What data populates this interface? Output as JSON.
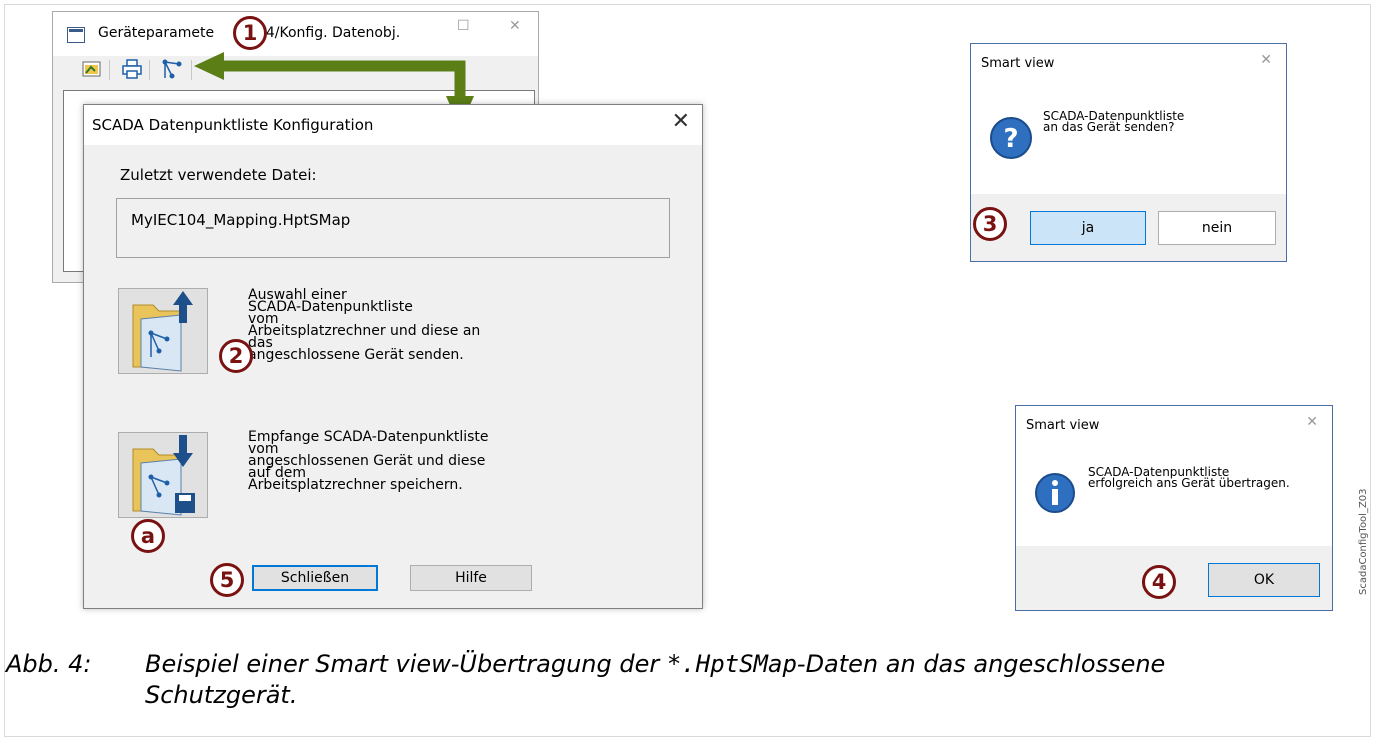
{
  "background_window": {
    "title": "Geräteparameter/IEC 104/Konfig. Datenobj.",
    "title_visible_left": "Geräteparamete",
    "title_visible_right": "104/Konfig. Datenobj."
  },
  "dialog": {
    "title": "SCADA Datenpunktliste Konfiguration",
    "last_file_label": "Zuletzt verwendete Datei:",
    "last_file_value": "MyIEC104_Mapping.HptSMap",
    "send_lines": [
      "Auswahl einer",
      "SCADA-Datenpunktliste",
      "vom",
      "Arbeitsplatzrechner und diese an",
      "das",
      "angeschlossene Gerät senden."
    ],
    "receive_lines": [
      "Empfange SCADA-Datenpunktliste",
      "vom",
      "angeschlossenen Gerät und diese",
      "auf dem",
      "Arbeitsplatzrechner speichern."
    ],
    "close_label": "Schließen",
    "help_label": "Hilfe"
  },
  "confirm_box": {
    "title": "Smart view",
    "line1": "SCADA-Datenpunktliste",
    "line2": "an das Gerät senden?",
    "yes_label": "ja",
    "no_label": "nein"
  },
  "info_box": {
    "title": "Smart view",
    "line1": "SCADA-Datenpunktliste",
    "line2": "erfolgreich ans Gerät übertragen.",
    "ok_label": "OK"
  },
  "callouts": {
    "c1": "1",
    "c2": "2",
    "c3": "3",
    "c4": "4",
    "c5": "5",
    "ca": "a"
  },
  "colors": {
    "callout": "#7a1212",
    "arrow": "#5b7f16",
    "accent": "#0078d7"
  },
  "caption": {
    "label": "Abb. 4:",
    "text_before": "Beispiel einer Smart view-Übertragung der ",
    "code": "*.HptSMap",
    "text_after": "-Daten an das angeschlossene",
    "line2": "Schutzgerät."
  },
  "side_tag": "ScadaConfigTool_Z03"
}
